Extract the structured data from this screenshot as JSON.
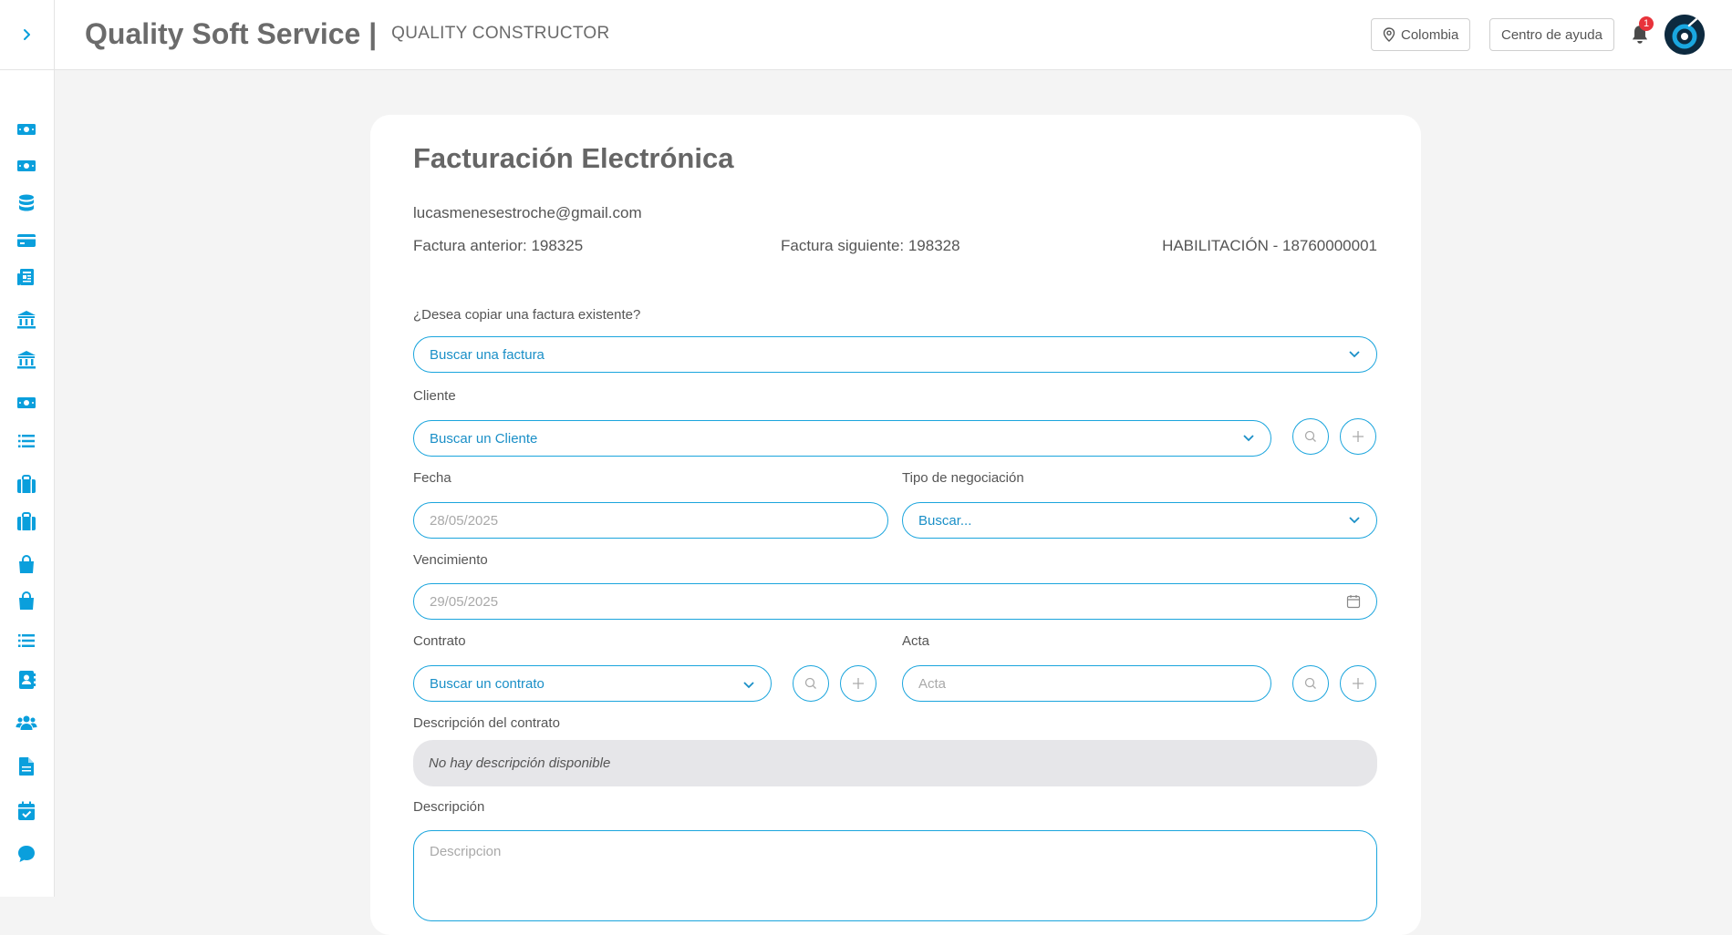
{
  "header": {
    "brand": "Quality Soft Service |",
    "module": "QUALITY CONSTRUCTOR",
    "country_button": "Colombia",
    "help_button": "Centro de ayuda",
    "notification_count": "1"
  },
  "sidebar": {
    "toggle_icon": "chevron-right-icon",
    "icons": [
      "money-bill-icon",
      "money-bill-icon",
      "database-icon",
      "credit-card-icon",
      "newspaper-icon",
      "bank-icon",
      "bank-icon",
      "money-bill-icon",
      "list-icon",
      "briefcase-icon",
      "briefcase-icon",
      "shopping-bag-icon",
      "shopping-bag-icon",
      "list-icon",
      "address-book-icon",
      "users-icon",
      "file-icon",
      "calendar-check-icon",
      "chat-icon"
    ]
  },
  "form": {
    "title": "Facturación Electrónica",
    "email": "lucasmenesestroche@gmail.com",
    "prev_invoice": "Factura anterior: 198325",
    "next_invoice": "Factura siguiente: 198328",
    "authorization": "HABILITACIÓN - 18760000001",
    "copy_label": "¿Desea copiar una factura existente?",
    "copy_value": "Buscar una factura",
    "client_label": "Cliente",
    "client_value": "Buscar un Cliente",
    "date_label": "Fecha",
    "date_value": "28/05/2025",
    "negotiation_label": "Tipo de negociación",
    "negotiation_value": "Buscar...",
    "due_label": "Vencimiento",
    "due_value": "29/05/2025",
    "contract_label": "Contrato",
    "contract_value": "Buscar un contrato",
    "act_label": "Acta",
    "act_placeholder": "Acta",
    "contract_desc_label": "Descripción del contrato",
    "contract_desc_value": "No hay descripción disponible",
    "desc_label": "Descripción",
    "desc_placeholder": "Descripcion"
  },
  "colors": {
    "accent": "#1ba5dd",
    "icon_blue": "#0a9fdc",
    "badge": "#e8333b"
  }
}
